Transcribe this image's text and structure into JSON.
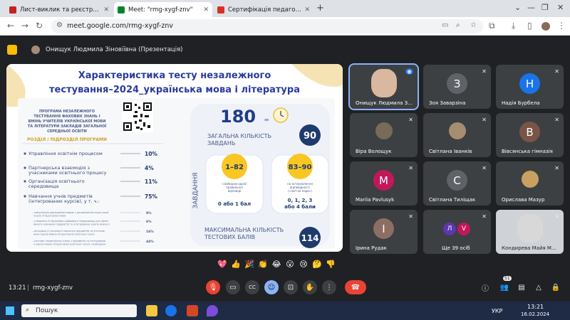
{
  "tabs": [
    {
      "label": "Лист-виклик та реєстрація ф",
      "color": "#c5221f",
      "active": false
    },
    {
      "label": "Meet: \"rmg-xygf-znv\"",
      "color": "#00832d",
      "active": true
    },
    {
      "label": "Сертифікація педагогічних пр",
      "color": "#d93025",
      "active": false
    }
  ],
  "address": {
    "url": "meet.google.com/rmg-xygf-znv"
  },
  "presenter": {
    "name": "Онищук Людмила Зіновіївна (Презентація)"
  },
  "slide": {
    "title_line1": "Характеристика тесту незалежного",
    "title_line2": "тестування–2024_українська мова і література",
    "program_text": "ПРОГРАМА НЕЗАЛЕЖНОГО ТЕСТУВАННЯ ФАХОВИХ ЗНАНЬ І ВМІНЬ УЧИТЕЛІВ УКРАЇНСЬКОЇ МОВИ ТА ЛІТЕРАТУРИ ЗАКЛАДІВ ЗАГАЛЬНОЇ СЕРЕДНЬОЇ ОСВІТИ",
    "section_header": "РОЗДІЛ / ПІДРОЗДІЛ ПРОГРАМИ",
    "sections": [
      {
        "label": "Управління освітнім процесом",
        "pct": "10%"
      },
      {
        "label": "Партнерська взаємодія з учасниками освітнього процесу",
        "pct": "4%"
      },
      {
        "label": "Організація освітнього середовища",
        "pct": "11%"
      },
      {
        "label": "Навчання учнів предметів (інтегрованих курсів), у т. ч.:",
        "pct": "75%"
      }
    ],
    "subsections": [
      {
        "label": "комунікація державною мовою з дотриманням норм української літературної мови",
        "pct": "9%"
      },
      {
        "label": "створення й підтримка цифрового середовища для ефективного навчання предметів та інтегрованих курсів мовно-літературної освітньої галузі",
        "pct": "6%"
      },
      {
        "label": "методики й технології навчання предметів та інтегрованих курсів мовно-літературної освітньої галузі",
        "pct": "16%"
      },
      {
        "label": "системи теоретичних знань з предметів та інтегрованих курсів мовно-літературної освітньої галузі, необхідних для реалізації вимог державних стандартів середньої освіти",
        "pct": "44%"
      }
    ],
    "time_value": "180",
    "time_unit": "хв",
    "total_tasks_label": "ЗАГАЛЬНА КІЛЬКІСТЬ ЗАВДАНЬ",
    "total_tasks_value": "90",
    "tasks_vertical": "ЗАВДАННЯ",
    "range1": "1–82",
    "range1_desc": "з вибором однієї правильної відповіді",
    "range1_score": "0 або 1 бал",
    "range2": "83–90",
    "range2_desc": "на встановлення відповідності («логічні пари»)",
    "range2_score": "0, 1, 2, 3 або 4 бали",
    "max_label": "МАКСИМАЛЬНА КІЛЬКІСТЬ ТЕСТОВИХ БАЛІВ",
    "max_value": "114"
  },
  "participants": [
    {
      "name": "Онищук Людмила З...",
      "letter": "",
      "color": "#d9b8a0",
      "photo": true
    },
    {
      "name": "Зоя Заварзіна",
      "letter": "З",
      "color": "#5f6368",
      "photo": false
    },
    {
      "name": "Надія Бурбела",
      "letter": "Н",
      "color": "#1a73e8",
      "photo": false
    },
    {
      "name": "Віра Волощук",
      "letter": "",
      "color": "#7a6a5a",
      "photo": true
    },
    {
      "name": "Світлана Іванків",
      "letter": "",
      "color": "#a78d6f",
      "photo": true
    },
    {
      "name": "Вівсянська гімназія",
      "letter": "В",
      "color": "#795548",
      "photo": false
    },
    {
      "name": "Mariia Pavlusyk",
      "letter": "M",
      "color": "#c2185b",
      "photo": false
    },
    {
      "name": "Світлана Тиліщак",
      "letter": "С",
      "color": "#5f6368",
      "photo": false
    },
    {
      "name": "Орислава Мазур",
      "letter": "",
      "color": "#c8a060",
      "photo": true
    },
    {
      "name": "Ірина Рудак",
      "letter": "І",
      "color": "#8d6e63",
      "photo": false
    },
    {
      "name": "Ще 39 осіб",
      "letter": "",
      "color": "#3c4043",
      "photo": false
    },
    {
      "name": "Кондирева Майя М...",
      "letter": "",
      "color": "#d8d8d8",
      "photo": true
    }
  ],
  "more_people_avatars": [
    "Л",
    "V"
  ],
  "reactions": [
    "💖",
    "👍",
    "🎉",
    "👏",
    "😂",
    "😮",
    "😢",
    "🤔",
    "👎"
  ],
  "controls": {
    "time": "13:21",
    "separator": "|",
    "meeting_code": "rmg-xygf-znv",
    "participants_count": "51"
  },
  "taskbar": {
    "search_placeholder": "Пошук",
    "lang": "УКР",
    "clock_time": "13:21",
    "clock_date": "16.02.2024"
  }
}
